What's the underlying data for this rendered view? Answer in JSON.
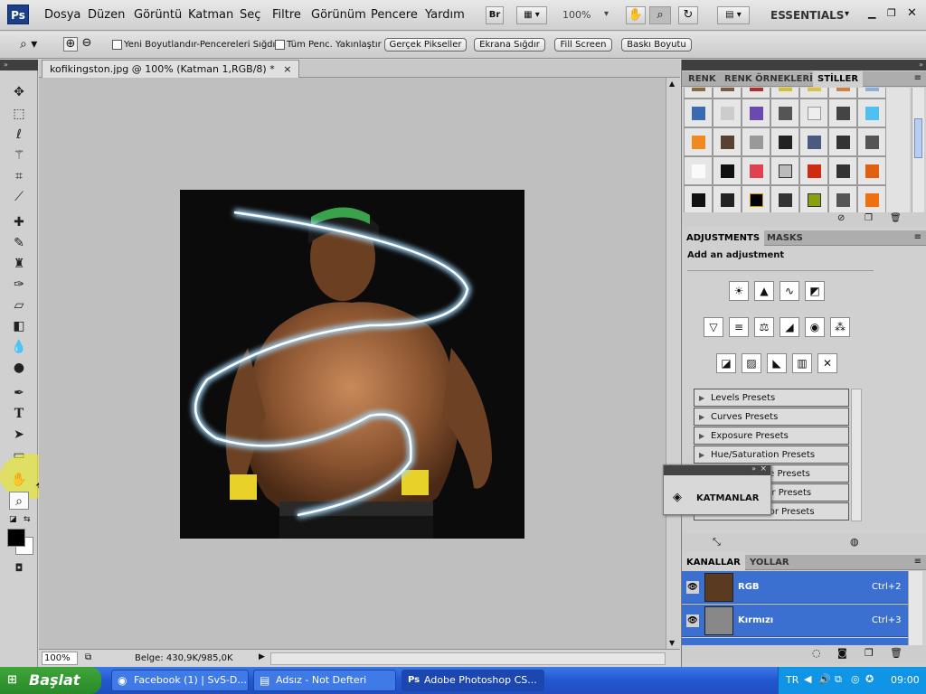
{
  "menubar": {
    "logo": "Ps",
    "items": [
      "Dosya",
      "Düzen",
      "Görüntü",
      "Katman",
      "Seç",
      "Filtre",
      "Görünüm",
      "Pencere",
      "Yardım"
    ],
    "bridge_label": "Br",
    "zoom": "100%",
    "workspace": "ESSENTIALS"
  },
  "options": {
    "checkbox1_label": "Yeni Boyutlandır-Pencereleri Sığdır",
    "checkbox2_label": "Tüm Penc. Yakınlaştır",
    "buttons": [
      "Gerçek Pikseller",
      "Ekrana Sığdır",
      "Fill Screen",
      "Baskı Boyutu"
    ]
  },
  "document": {
    "tab_title": "kofikingston.jpg @ 100% (Katman 1,RGB/8) *",
    "zoom_field": "100%",
    "status": "Belge: 430,9K/985,0K"
  },
  "panels": {
    "top_tabs": [
      "RENK",
      "RENK ÖRNEKLERİ",
      "STİLLER"
    ],
    "adjust_tabs": [
      "ADJUSTMENTS",
      "MASKS"
    ],
    "adjust_title": "Add an adjustment",
    "presets": [
      "Levels Presets",
      "Curves Presets",
      "Exposure Presets",
      "Hue/Saturation Presets",
      "Black & White Presets",
      "Channel Mixer Presets",
      "Selective Color Presets"
    ],
    "floating_label": "KATMANLAR",
    "bottom_tabs": [
      "KANALLAR",
      "YOLLAR"
    ],
    "channels": [
      {
        "name": "RGB",
        "shortcut": "Ctrl+2"
      },
      {
        "name": "Kırmızı",
        "shortcut": "Ctrl+3"
      }
    ]
  },
  "taskbar": {
    "start": "Başlat",
    "tasks": [
      "Facebook (1) | SvS-D...",
      "Adsız - Not Defteri",
      "Adobe Photoshop CS..."
    ],
    "lang": "TR",
    "clock": "09:00"
  }
}
